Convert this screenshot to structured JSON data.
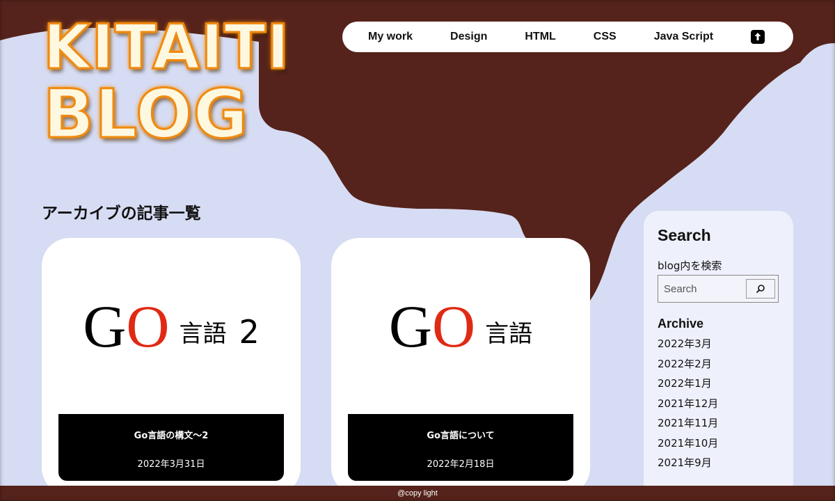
{
  "site": {
    "logo_line1": "KITAITI",
    "logo_line2": "BLOG"
  },
  "nav": {
    "items": [
      {
        "label": "My work"
      },
      {
        "label": "Design"
      },
      {
        "label": "HTML"
      },
      {
        "label": "CSS"
      },
      {
        "label": "Java Script"
      }
    ],
    "icon": "upload-icon"
  },
  "main": {
    "heading": "アーカイブの記事一覧",
    "posts": [
      {
        "hero_g": "G",
        "hero_o": "O",
        "hero_sub": "言語",
        "hero_num": "2",
        "title": "Go言語の構文〜2",
        "date": "2022年3月31日"
      },
      {
        "hero_g": "G",
        "hero_o": "O",
        "hero_sub": "言語",
        "title": "Go言語について",
        "date": "2022年2月18日"
      }
    ]
  },
  "sidebar": {
    "search_heading": "Search",
    "search_label": "blog内を検索",
    "search_placeholder": "Search",
    "search_icon": "search-icon",
    "archive_heading": "Archive",
    "archive_items": [
      "2022年3月",
      "2022年2月",
      "2022年1月",
      "2021年12月",
      "2021年11月",
      "2021年10月",
      "2021年9月"
    ]
  },
  "footer": {
    "text": "@copy light"
  },
  "colors": {
    "background": "#d6dcf3",
    "chocolate": "#55231b",
    "logo_orange": "#f08a10",
    "go_red": "#e02a14"
  }
}
